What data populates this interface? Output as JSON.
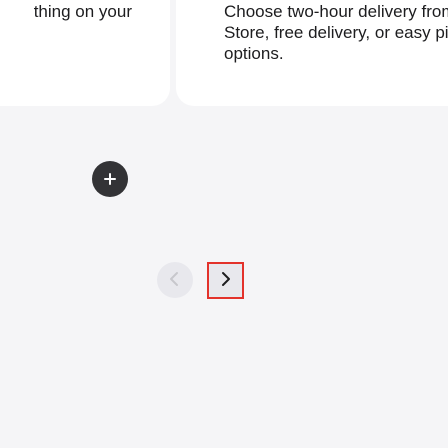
{
  "cards": {
    "left": {
      "text": "thing on your"
    },
    "right": {
      "text": "Choose two-hour delivery from Apple Store, free delivery, or easy pickup options."
    }
  },
  "icons": {
    "more_info": "plus-icon",
    "previous": "chevron-left-icon",
    "next": "chevron-right-icon"
  },
  "colors": {
    "background": "#f5f5f7",
    "card": "#ffffff",
    "text": "#1d1d1f",
    "plus_button": "#333336",
    "nav_button": "#e8e8ed",
    "focus_outline": "#e3322b",
    "chevron_disabled": "#c7c7cc",
    "chevron_active": "#1d1d1f"
  }
}
